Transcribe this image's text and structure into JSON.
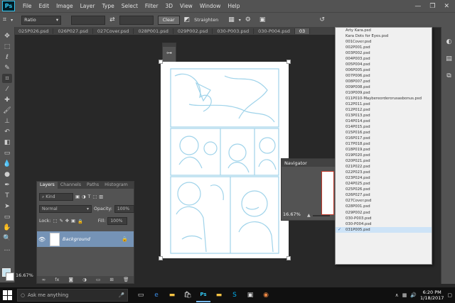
{
  "app": {
    "logo": "Ps"
  },
  "menu": [
    "File",
    "Edit",
    "Image",
    "Layer",
    "Type",
    "Select",
    "Filter",
    "3D",
    "View",
    "Window",
    "Help"
  ],
  "window_controls": {
    "minimize": "—",
    "restore": "❐",
    "close": "✕"
  },
  "options_bar": {
    "ratio_label": "Ratio",
    "clear_label": "Clear",
    "straighten_label": "Straighten",
    "icons": [
      "crop-icon",
      "swap-icon",
      "grid-overlay-icon",
      "gear-icon",
      "content-aware-icon",
      "reset-icon"
    ]
  },
  "tabs": [
    "025P026.psd",
    "026P027.psd",
    "027Cover.psd",
    "028P001.psd",
    "029P002.psd",
    "030-P003.psd",
    "030-P004.psd",
    "03"
  ],
  "active_tab_index": 7,
  "layers_panel": {
    "tabs": [
      "Layers",
      "Channels",
      "Paths",
      "Histogram"
    ],
    "filter_kind": "Kind",
    "blend_mode": "Normal",
    "opacity_label": "Opacity:",
    "opacity_value": "100%",
    "lock_label": "Lock:",
    "fill_label": "Fill:",
    "fill_value": "100%",
    "layer_name": "Background",
    "footer_icons": [
      "link-icon",
      "fx-icon",
      "mask-icon",
      "adjustment-icon",
      "folder-icon",
      "new-layer-icon",
      "trash-icon"
    ]
  },
  "navigator": {
    "title": "Navigator",
    "zoom": "16.67%"
  },
  "status": {
    "zoom": "16.67%"
  },
  "file_list": {
    "items": [
      "Arty Kara.psd",
      "Kara Dots for Eyes.psd",
      "001Cover.psd",
      "002P001.psd",
      "003P002.psd",
      "004P003.psd",
      "005P004.psd",
      "006P005.psd",
      "007P006.psd",
      "008P007.psd",
      "009P008.psd",
      "010P009.psd",
      "011P010-Maybereorderorusasbonus.psd",
      "012P011.psd",
      "012P012.psd",
      "013P013.psd",
      "014P014.psd",
      "014P015.psd",
      "015P016.psd",
      "016P017.psd",
      "017P018.psd",
      "018P019.psd",
      "019P020.psd",
      "020P021.psd",
      "021P022.psd",
      "022P023.psd",
      "023P024.psd",
      "024P025.psd",
      "025P026.psd",
      "026P027.psd",
      "027Cover.psd",
      "028P001.psd",
      "029P002.psd",
      "030-P003.psd",
      "030-P004.psd",
      "031P005.psd"
    ],
    "selected_index": 35,
    "check": "✓"
  },
  "taskbar": {
    "search_placeholder": "Ask me anything",
    "time": "6:20 PM",
    "date": "1/18/2017"
  },
  "colors": {
    "accent": "#31c5f0",
    "layer_selected": "#7593b6",
    "sketch_line": "#9fd3ea"
  }
}
